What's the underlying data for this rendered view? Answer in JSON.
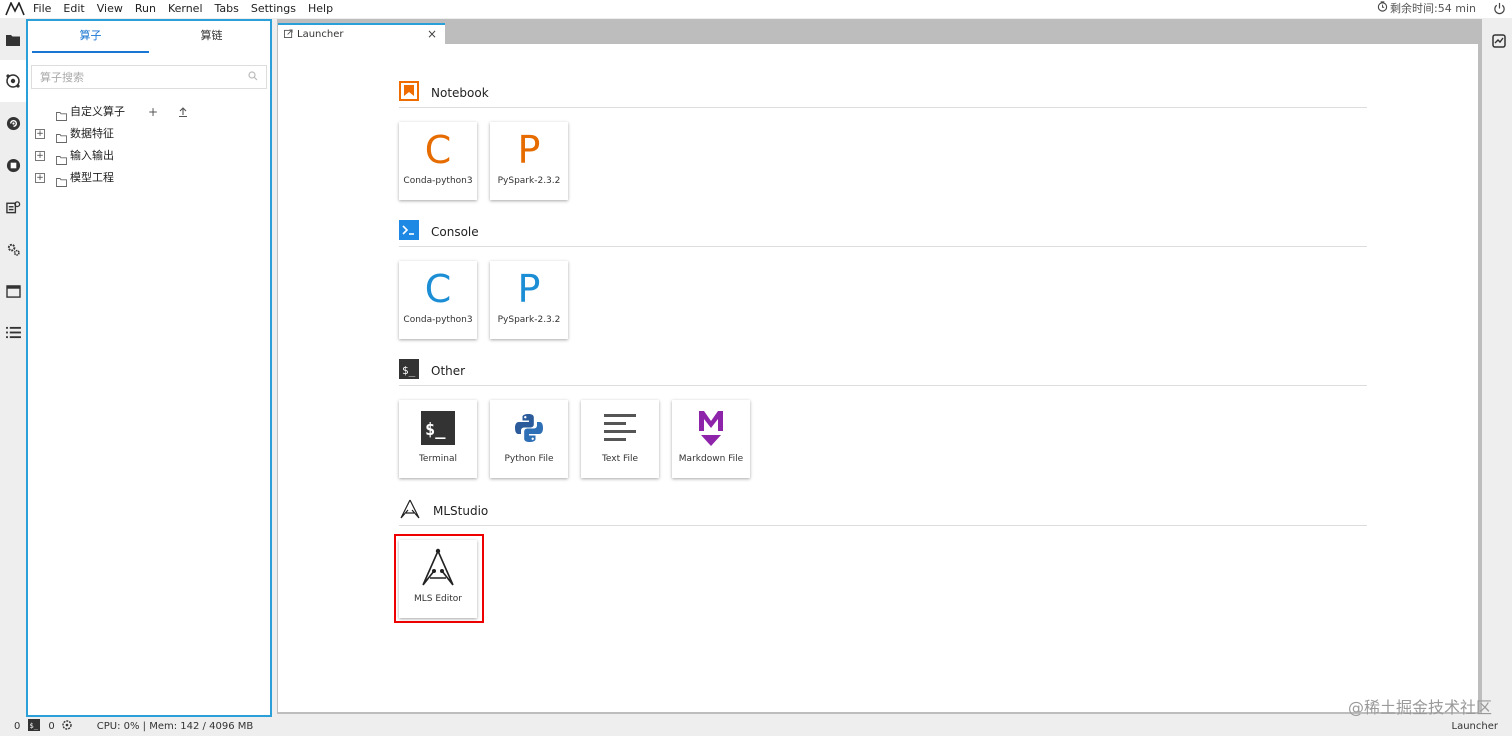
{
  "menubar": {
    "items": [
      "File",
      "Edit",
      "View",
      "Run",
      "Kernel",
      "Tabs",
      "Settings",
      "Help"
    ],
    "timer": "剩余时间:54 min"
  },
  "sidepanel": {
    "tabs": [
      "算子",
      "算链"
    ],
    "search_placeholder": "算子搜索",
    "tree": [
      "自定义算子",
      "数据特征",
      "输入输出",
      "模型工程"
    ],
    "tree_add": "+"
  },
  "tab": {
    "title": "Launcher",
    "close": "×"
  },
  "launcher": {
    "sections": [
      {
        "title": "Notebook",
        "items": [
          {
            "letter": "C",
            "label": "Conda-python3"
          },
          {
            "letter": "P",
            "label": "PySpark-2.3.2"
          }
        ]
      },
      {
        "title": "Console",
        "items": [
          {
            "letter": "C",
            "label": "Conda-python3"
          },
          {
            "letter": "P",
            "label": "PySpark-2.3.2"
          }
        ]
      },
      {
        "title": "Other",
        "items": [
          {
            "icon": "terminal-icon",
            "label": "Terminal"
          },
          {
            "icon": "python-icon",
            "label": "Python File"
          },
          {
            "icon": "text-file-icon",
            "label": "Text File"
          },
          {
            "icon": "markdown-icon",
            "label": "Markdown File"
          }
        ]
      },
      {
        "title": "MLStudio",
        "items": [
          {
            "icon": "mls-editor-icon",
            "label": "MLS Editor"
          }
        ]
      }
    ]
  },
  "statusbar": {
    "count1": "0",
    "count2": "0",
    "resources": "CPU: 0% | Mem: 142 / 4096 MB",
    "mode": "Launcher"
  },
  "watermark": "@稀土掘金技术社区",
  "colors": {
    "accent": "#2a9fd8",
    "notebook_orange": "#e66c00",
    "console_blue": "#1b8ed6",
    "markdown_purple": "#8e24aa",
    "highlight_red": "#e00000"
  }
}
